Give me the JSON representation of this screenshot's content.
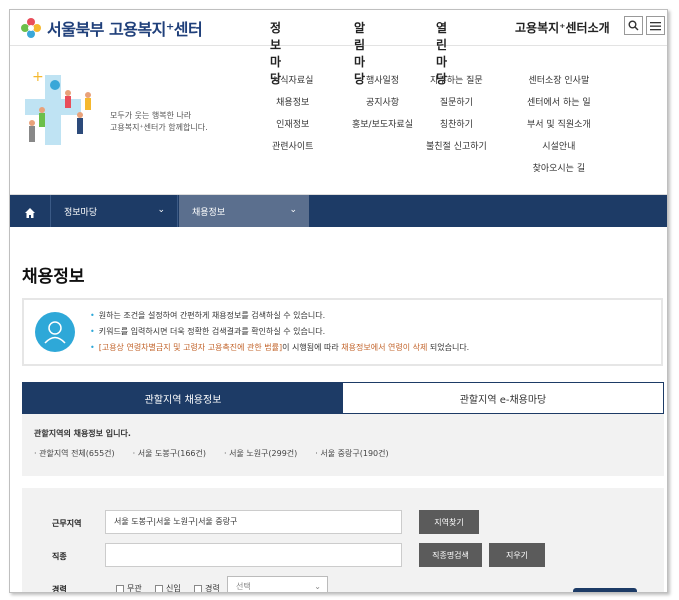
{
  "header": {
    "logo_text": "서울북부 고용복지⁺센터",
    "nav": [
      "정보마당",
      "알림마당",
      "열린마당",
      "고용복지⁺센터소개"
    ]
  },
  "mega": {
    "tagline": [
      "모두가 웃는 행복한 나라",
      "고용복지⁺센터가 함께합니다."
    ],
    "col1": [
      "서식자료실",
      "채용정보",
      "인재정보",
      "관련사이트"
    ],
    "col2": [
      "행사일정",
      "공지사항",
      "홍보/보도자료실"
    ],
    "col3": [
      "자주하는 질문",
      "질문하기",
      "칭찬하기",
      "불친절 신고하기"
    ],
    "col4": [
      "센터소장 인사말",
      "센터에서 하는 일",
      "부서 및 직원소개",
      "시설안내",
      "찾아오시는 길"
    ]
  },
  "breadcrumb": {
    "level1": "정보마당",
    "level2": "채용정보"
  },
  "page_title": "채용정보",
  "info": {
    "line1": "원하는 조건을 설정하여 간편하게 채용정보를 검색하실 수 있습니다.",
    "line2": "키워드를 입력하시면 더욱 정확한 검색결과를 확인하실 수 있습니다.",
    "line3_a": "[고용상 연령차별금지 및 고령자 고용촉진에 관한 법률]",
    "line3_b": "이 시행됨에 따라 ",
    "line3_c": "채용정보에서 연령이 삭제",
    "line3_d": " 되었습니다."
  },
  "tabs": [
    "관할지역 채용정보",
    "관할지역 e-채용마당"
  ],
  "summary": {
    "title": "관할지역의 채용정보 입니다.",
    "items": [
      "관할지역 전체(655건)",
      "서울 도봉구(166건)",
      "서울 노원구(299건)",
      "서울 중랑구(190건)"
    ]
  },
  "form": {
    "region_label": "근무지역",
    "region_value": "서울 도봉구|서울 노원구|서울 중랑구",
    "region_btn": "지역찾기",
    "job_label": "직종",
    "job_value": "",
    "job_btn": "직종명검색",
    "clear_btn": "지우기",
    "career_label": "경력",
    "career_opts": [
      "무관",
      "신입",
      "경력"
    ],
    "career_select": "선택"
  },
  "colors": {
    "navy": "#1d3b66",
    "accent": "#2ea8d8",
    "highlight": "#c2632a"
  }
}
